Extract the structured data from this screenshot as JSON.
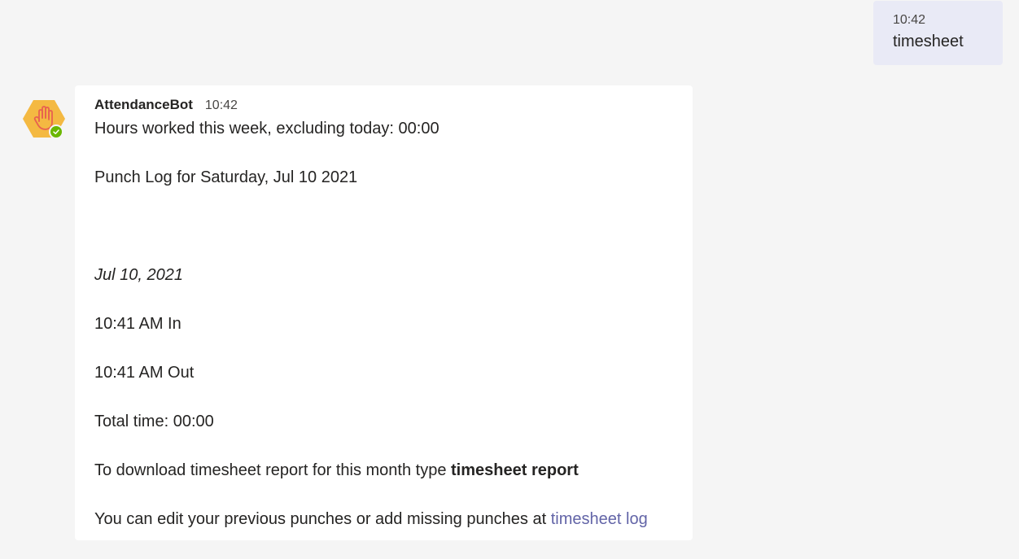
{
  "user_message": {
    "time": "10:42",
    "text": "timesheet"
  },
  "bot_message": {
    "sender": "AttendanceBot",
    "time": "10:42",
    "hours_line": "Hours worked this week, excluding today: 00:00",
    "punch_log_title": "Punch Log for Saturday, Jul 10 2021",
    "date": "Jul 10, 2021",
    "punch_in": "10:41 AM In",
    "punch_out": "10:41 AM Out",
    "total_time": "Total time: 00:00",
    "download_prefix": "To download timesheet report for this month type ",
    "download_command": "timesheet report",
    "edit_prefix": "You can edit your previous punches or add missing punches at ",
    "edit_link": "timesheet log"
  },
  "avatar": {
    "icon": "raised-hand-icon",
    "badge_icon": "checkmark-icon",
    "status": "available",
    "hex_color": "#f4b942",
    "hand_color": "#e8624f",
    "status_color": "#6bb700"
  }
}
